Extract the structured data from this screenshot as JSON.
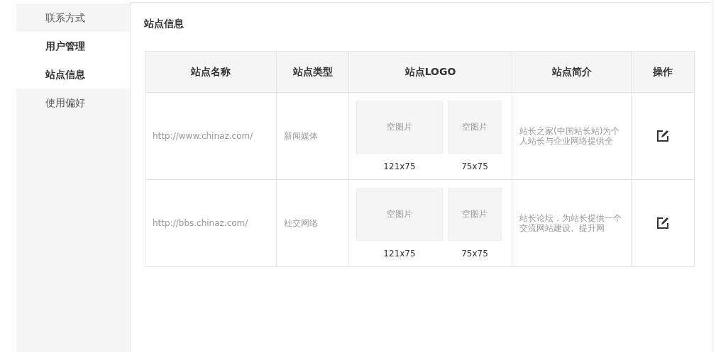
{
  "sidebar": {
    "items": [
      {
        "label": "联系方式",
        "kind": "link",
        "selected": false
      },
      {
        "label": "用户管理",
        "kind": "group"
      },
      {
        "label": "站点信息",
        "kind": "link",
        "selected": true
      },
      {
        "label": "使用偏好",
        "kind": "link",
        "selected": false
      }
    ]
  },
  "panel": {
    "title": "站点信息"
  },
  "table": {
    "columns": [
      "站点名称",
      "站点类型",
      "站点LOGO",
      "站点简介",
      "操作"
    ],
    "rows": [
      {
        "url": "http://www.chinaz.com/",
        "type": "新闻媒体",
        "logos": [
          {
            "empty_text": "空图片",
            "size": "121x75"
          },
          {
            "empty_text": "空图片",
            "size": "75x75"
          }
        ],
        "intro": "站长之家(中国站长站)为个人站长与企业网络提供全"
      },
      {
        "url": "http://bbs.chinaz.com/",
        "type": "社交网络",
        "logos": [
          {
            "empty_text": "空图片",
            "size": "121x75"
          },
          {
            "empty_text": "空图片",
            "size": "75x75"
          }
        ],
        "intro": "站长论坛，为站长提供一个交流网站建设、提升网"
      }
    ]
  }
}
